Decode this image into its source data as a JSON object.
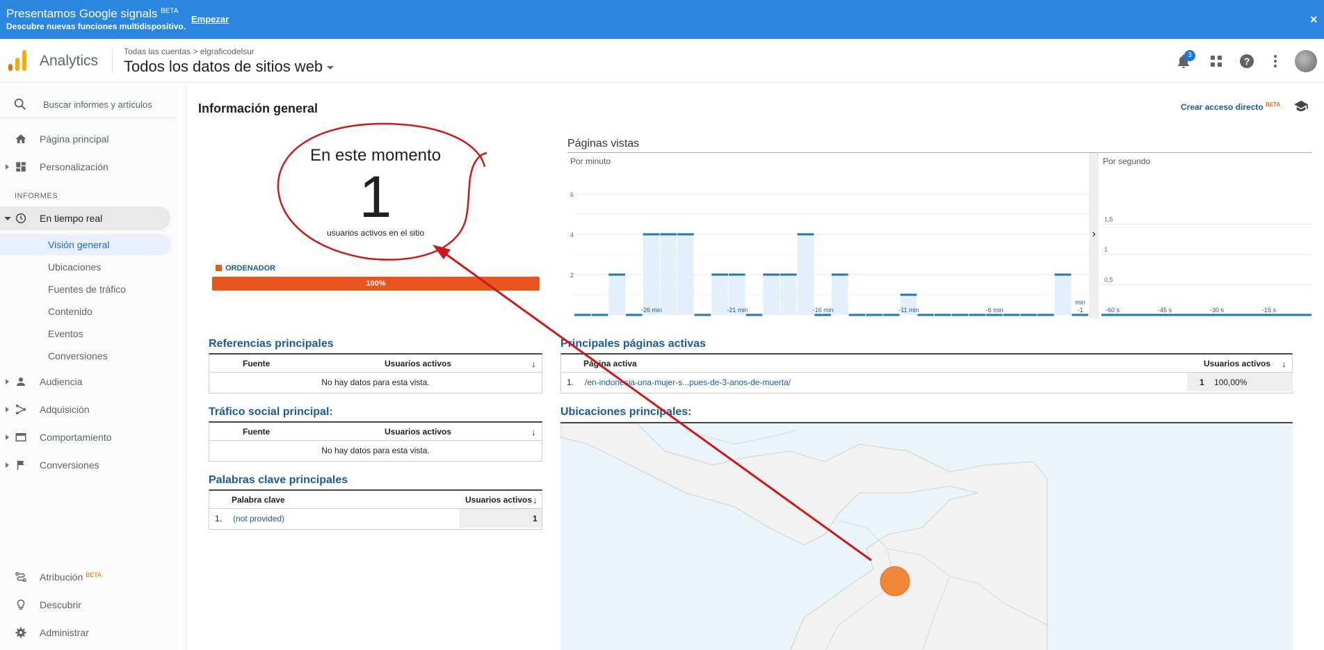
{
  "banner": {
    "title": "Presentamos Google signals",
    "title_sup": "BETA",
    "subtitle": "Descubre nuevas funciones multidispositivo.",
    "link": "Empezar",
    "close": "×"
  },
  "header": {
    "app_name": "Analytics",
    "breadcrumb": "Todas las cuentas > elgraficodelsur",
    "property": "Todos los datos de sitios web",
    "notification_count": "3"
  },
  "sidebar": {
    "search_placeholder": "Buscar informes y artículos",
    "home": "Página principal",
    "custom": "Personalización",
    "section": "INFORMES",
    "realtime": "En tiempo real",
    "realtime_items": [
      "Visión general",
      "Ubicaciones",
      "Fuentes de tráfico",
      "Contenido",
      "Eventos",
      "Conversiones"
    ],
    "audience": "Audiencia",
    "acquisition": "Adquisición",
    "behavior": "Comportamiento",
    "conversions": "Conversiones",
    "attribution": "Atribución",
    "attribution_sup": "BETA",
    "discover": "Descubrir",
    "admin": "Administrar"
  },
  "overview": {
    "title": "Información general",
    "shortcut": "Crear acceso directo",
    "shortcut_sup": "BETA",
    "now_title": "En este momento",
    "now_value": "1",
    "now_sub": "usuarios activos en el sitio",
    "device_label": "ORDENADOR",
    "device_pct": "100%"
  },
  "chart_data": {
    "type": "bar",
    "title": "Páginas vistas",
    "per_minute": {
      "label": "Por minuto",
      "y_ticks": [
        "6",
        "4",
        "2"
      ],
      "ylim": [
        0,
        6
      ],
      "x_ticks": [
        "-26 min",
        "-21 min",
        "-16 min",
        "-11 min",
        "-6 min",
        "-1"
      ],
      "x_extra": "min",
      "values": [
        0,
        0,
        2,
        0,
        4,
        4,
        4,
        0,
        2,
        2,
        0,
        2,
        2,
        4,
        0,
        2,
        0,
        0,
        0,
        1,
        0,
        0,
        0,
        0,
        0,
        0,
        0,
        0,
        2,
        0
      ]
    },
    "per_second": {
      "label": "Por segundo",
      "y_ticks": [
        "1,5",
        "1",
        "0,5"
      ],
      "ylim": [
        0,
        2
      ],
      "x_ticks": [
        "-60 s",
        "-45 s",
        "-30 s",
        "-15 s"
      ]
    }
  },
  "referrals": {
    "title": "Referencias principales",
    "col1": "Fuente",
    "col2": "Usuarios activos",
    "empty": "No hay datos para esta vista."
  },
  "social": {
    "title": "Tráfico social principal:",
    "col1": "Fuente",
    "col2": "Usuarios activos",
    "empty": "No hay datos para esta vista."
  },
  "keywords": {
    "title": "Palabras clave principales",
    "col1": "Palabra clave",
    "col2": "Usuarios activos",
    "rows": [
      {
        "idx": "1.",
        "name": "(not provided)",
        "value": "1"
      }
    ]
  },
  "pages": {
    "title": "Principales páginas activas",
    "col1": "Página activa",
    "col2": "Usuarios activos",
    "rows": [
      {
        "idx": "1.",
        "name": "/en-indonesia-una-mujer-s...pues-de-3-anos-de-muerta/",
        "value": "1",
        "pct": "100,00%"
      }
    ]
  },
  "locations": {
    "title": "Ubicaciones principales:"
  },
  "colors": {
    "banner": "#2b86e0",
    "accent": "#e8561d",
    "link": "#1a5a96",
    "annotation": "#d01616"
  }
}
